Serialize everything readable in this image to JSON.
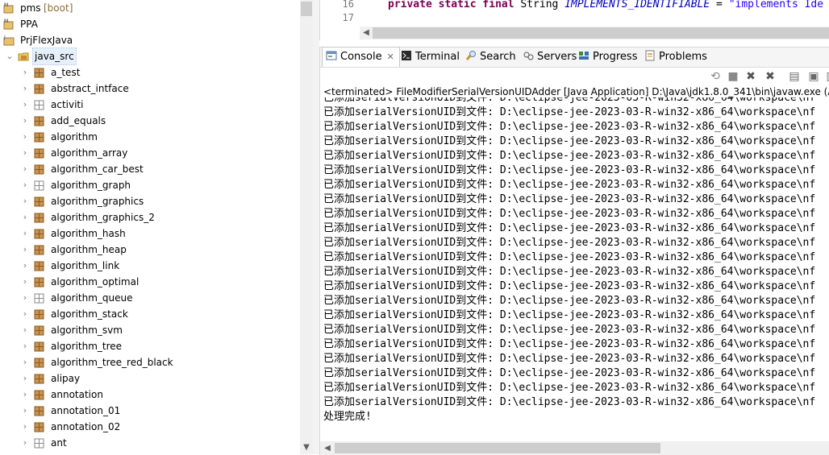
{
  "tree": {
    "items": [
      {
        "label": "pms",
        "decoration": "[boot]",
        "icon": "maven-project-icon",
        "level": 0,
        "expanded": false
      },
      {
        "label": "PPA",
        "icon": "maven-project-icon",
        "level": 0,
        "expanded": false
      },
      {
        "label": "PrjFlexJava",
        "icon": "java-project-icon",
        "level": 0,
        "expanded": false
      },
      {
        "label": "java_src",
        "icon": "source-folder-icon",
        "level": 0,
        "expanded": true,
        "selected": true
      },
      {
        "label": "a_test",
        "icon": "package-icon",
        "level": 1
      },
      {
        "label": "abstract_intface",
        "icon": "package-icon",
        "level": 1
      },
      {
        "label": "activiti",
        "icon": "package-outline-icon",
        "level": 1
      },
      {
        "label": "add_equals",
        "icon": "package-icon",
        "level": 1
      },
      {
        "label": "algorithm",
        "icon": "package-icon",
        "level": 1
      },
      {
        "label": "algorithm_array",
        "icon": "package-icon",
        "level": 1
      },
      {
        "label": "algorithm_car_best",
        "icon": "package-icon",
        "level": 1
      },
      {
        "label": "algorithm_graph",
        "icon": "package-outline-icon",
        "level": 1
      },
      {
        "label": "algorithm_graphics",
        "icon": "package-icon",
        "level": 1
      },
      {
        "label": "algorithm_graphics_2",
        "icon": "package-icon",
        "level": 1
      },
      {
        "label": "algorithm_hash",
        "icon": "package-icon",
        "level": 1
      },
      {
        "label": "algorithm_heap",
        "icon": "package-icon",
        "level": 1
      },
      {
        "label": "algorithm_link",
        "icon": "package-icon",
        "level": 1
      },
      {
        "label": "algorithm_optimal",
        "icon": "package-icon",
        "level": 1
      },
      {
        "label": "algorithm_queue",
        "icon": "package-outline-icon",
        "level": 1
      },
      {
        "label": "algorithm_stack",
        "icon": "package-icon",
        "level": 1
      },
      {
        "label": "algorithm_svm",
        "icon": "package-icon",
        "level": 1
      },
      {
        "label": "algorithm_tree",
        "icon": "package-icon",
        "level": 1
      },
      {
        "label": "algorithm_tree_red_black",
        "icon": "package-icon",
        "level": 1
      },
      {
        "label": "alipay",
        "icon": "package-icon",
        "level": 1
      },
      {
        "label": "annotation",
        "icon": "package-icon",
        "level": 1
      },
      {
        "label": "annotation_01",
        "icon": "package-icon",
        "level": 1
      },
      {
        "label": "annotation_02",
        "icon": "package-icon",
        "level": 1
      },
      {
        "label": "ant",
        "icon": "package-outline-icon",
        "level": 1
      }
    ]
  },
  "editor": {
    "line_numbers": [
      "16",
      "17"
    ],
    "code": {
      "kw1": "private",
      "kw2": "static",
      "kw3": "final",
      "type": "String",
      "field": "IMPLEMENTS_IDENTIFIABLE",
      "op": "=",
      "string": "\"implements Ide"
    }
  },
  "console": {
    "tabs": [
      {
        "label": "Console",
        "icon": "console-icon",
        "active": true,
        "close": "✕"
      },
      {
        "label": "Terminal",
        "icon": "terminal-icon"
      },
      {
        "label": "Search",
        "icon": "search-icon"
      },
      {
        "label": "Servers",
        "icon": "servers-icon"
      },
      {
        "label": "Progress",
        "icon": "progress-icon"
      },
      {
        "label": "Problems",
        "icon": "problems-icon"
      }
    ],
    "description": "<terminated> FileModifierSerialVersionUIDAdder [Java Application] D:\\Java\\jdk1.8.0_341\\bin\\javaw.exe (Apr",
    "output_line": "已添加serialVersionUID到文件: D:\\eclipse-jee-2023-03-R-win32-x86_64\\workspace\\nf",
    "output_count": 22,
    "final_line": "处理完成!"
  },
  "colors": {
    "keyword": "#7f0055",
    "field": "#0000c0",
    "string": "#2a00ff"
  }
}
